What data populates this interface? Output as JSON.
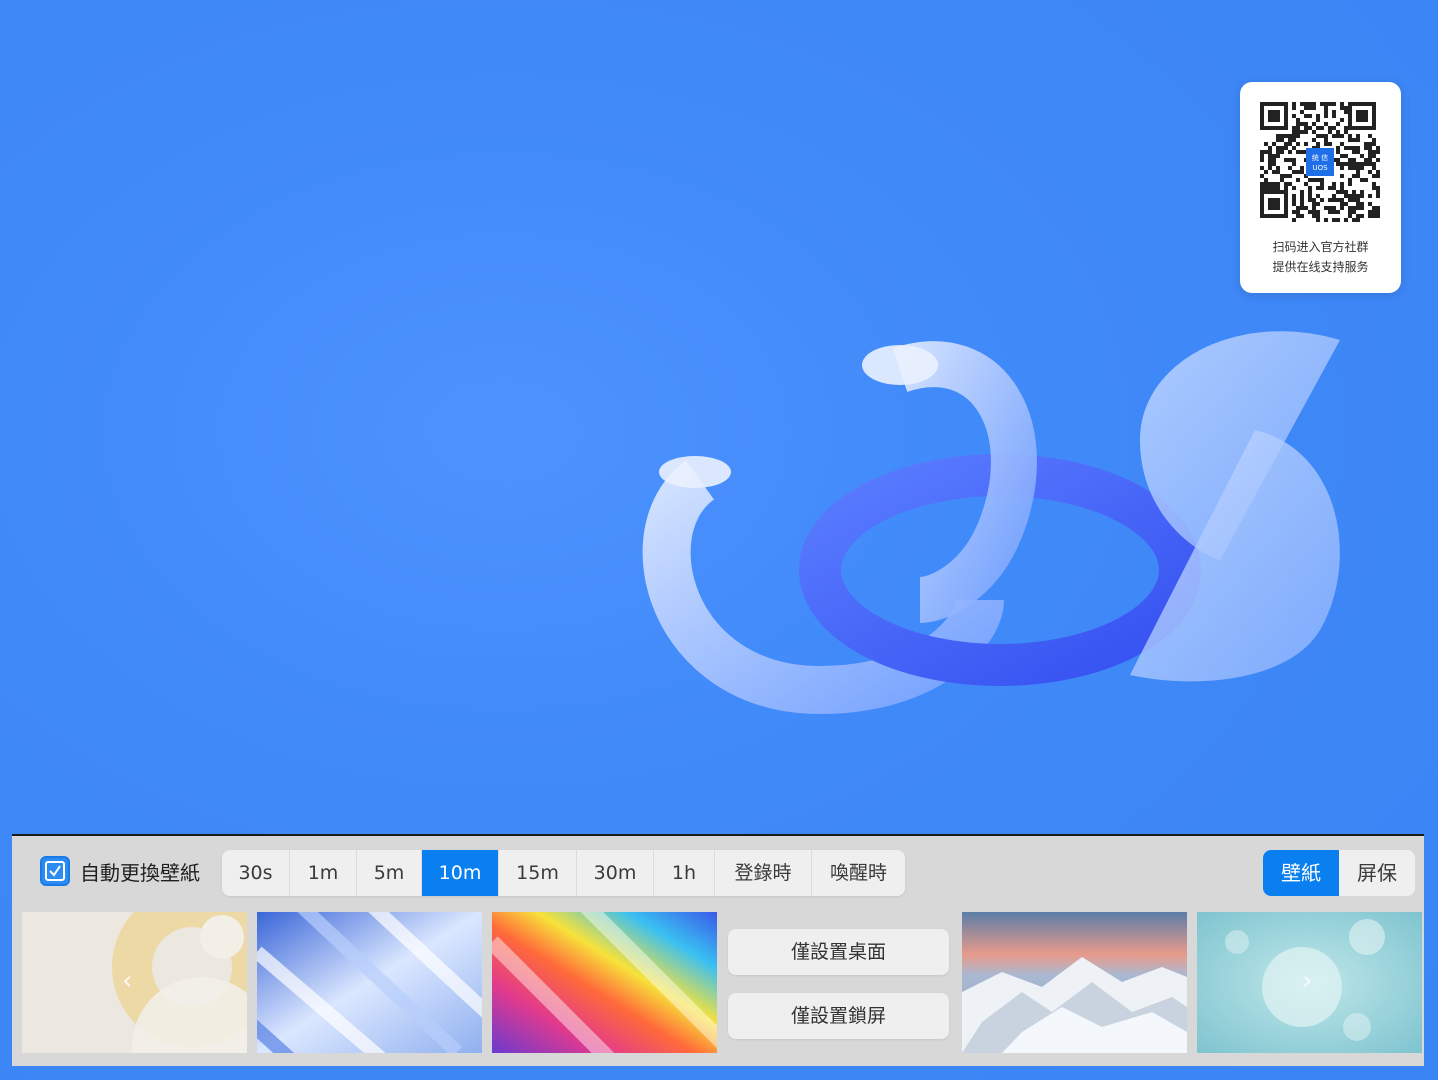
{
  "qr_card": {
    "line1": "扫码进入官方社群",
    "line2": "提供在线支持服务",
    "logo_text_top": "统 信",
    "logo_text_bottom": "UOS"
  },
  "panel": {
    "auto_change": {
      "label": "自動更換壁紙",
      "checked": true
    },
    "intervals": [
      "30s",
      "1m",
      "5m",
      "10m",
      "15m",
      "30m",
      "1h",
      "登錄時",
      "喚醒時"
    ],
    "selected_interval": "10m",
    "modes": [
      "壁紙",
      "屏保"
    ],
    "selected_mode": "壁紙",
    "set_desktop_label": "僅設置桌面",
    "set_lockscreen_label": "僅設置鎖屏",
    "prev_icon": "‹",
    "next_icon": "›",
    "wallpapers": [
      "circles-beige",
      "blue-streaks",
      "rainbow-streaks",
      "snow-mountain-sunset",
      "jellyfish-teal"
    ]
  },
  "colors": {
    "accent": "#0a7ff0",
    "desktop_bg": "#418af9",
    "panel_bg": "#d8d8d8"
  }
}
